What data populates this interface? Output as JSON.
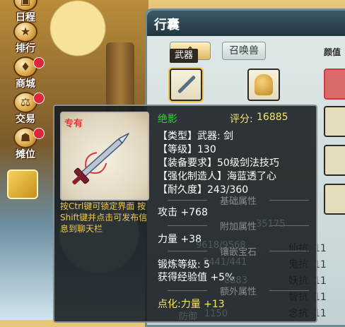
{
  "nav": {
    "items": [
      {
        "label": "日程",
        "icon": "calendar-icon",
        "dot": false
      },
      {
        "label": "排行",
        "icon": "ranking-icon",
        "dot": false
      },
      {
        "label": "商城",
        "icon": "shop-icon",
        "dot": true
      },
      {
        "label": "交易",
        "icon": "trade-icon",
        "dot": true
      },
      {
        "label": "摊位",
        "icon": "stall-icon",
        "dot": true
      }
    ]
  },
  "panel": {
    "title": "行囊",
    "tabs": [
      {
        "label": "武器"
      },
      {
        "label": "召唤兽"
      }
    ],
    "active_tab_chip": "武器",
    "beauty_label": "颜值",
    "resists": [
      {
        "label": "仙抗",
        "value": "11"
      },
      {
        "label": "鬼抗",
        "value": "11"
      },
      {
        "label": "妖抗",
        "value": "11"
      },
      {
        "label": "智抗",
        "value": "11"
      },
      {
        "label": "念抗",
        "value": "11"
      }
    ],
    "faint_bg": [
      "35175",
      "9618/9568",
      "3441/441",
      "8883",
      "1150",
      "防御"
    ]
  },
  "tooltip": {
    "exclusive": "专有",
    "name": "绝影",
    "score_label": "评分:",
    "score": "16885",
    "type_line": "【类型】武器: 剑",
    "level_line": "【等级】130",
    "req_line": "【装备要求】50级剑法技巧",
    "maker_line": "【强化制造人】海蓝透了心",
    "durability_line": "【耐久度】243/360",
    "hint": "按Ctrl键可锁定界面 按Shift键并点击可发布信息到聊天栏",
    "sections": {
      "base": "基础属性",
      "extra": "附加属性",
      "gem": "镶嵌宝石",
      "more": "额外属性"
    },
    "attack": "攻击 +768",
    "strength": "力量 +38",
    "forge_level": "锻炼等级: 5",
    "exp_gain": "获得经验值 +5%",
    "dianhua": "点化:力量 +13"
  },
  "colors": {
    "name_green": "#31d23a",
    "score_yellow": "#f3e66a",
    "exclusive_red": "#e43a3a",
    "hint_gold": "#f2c84b"
  }
}
